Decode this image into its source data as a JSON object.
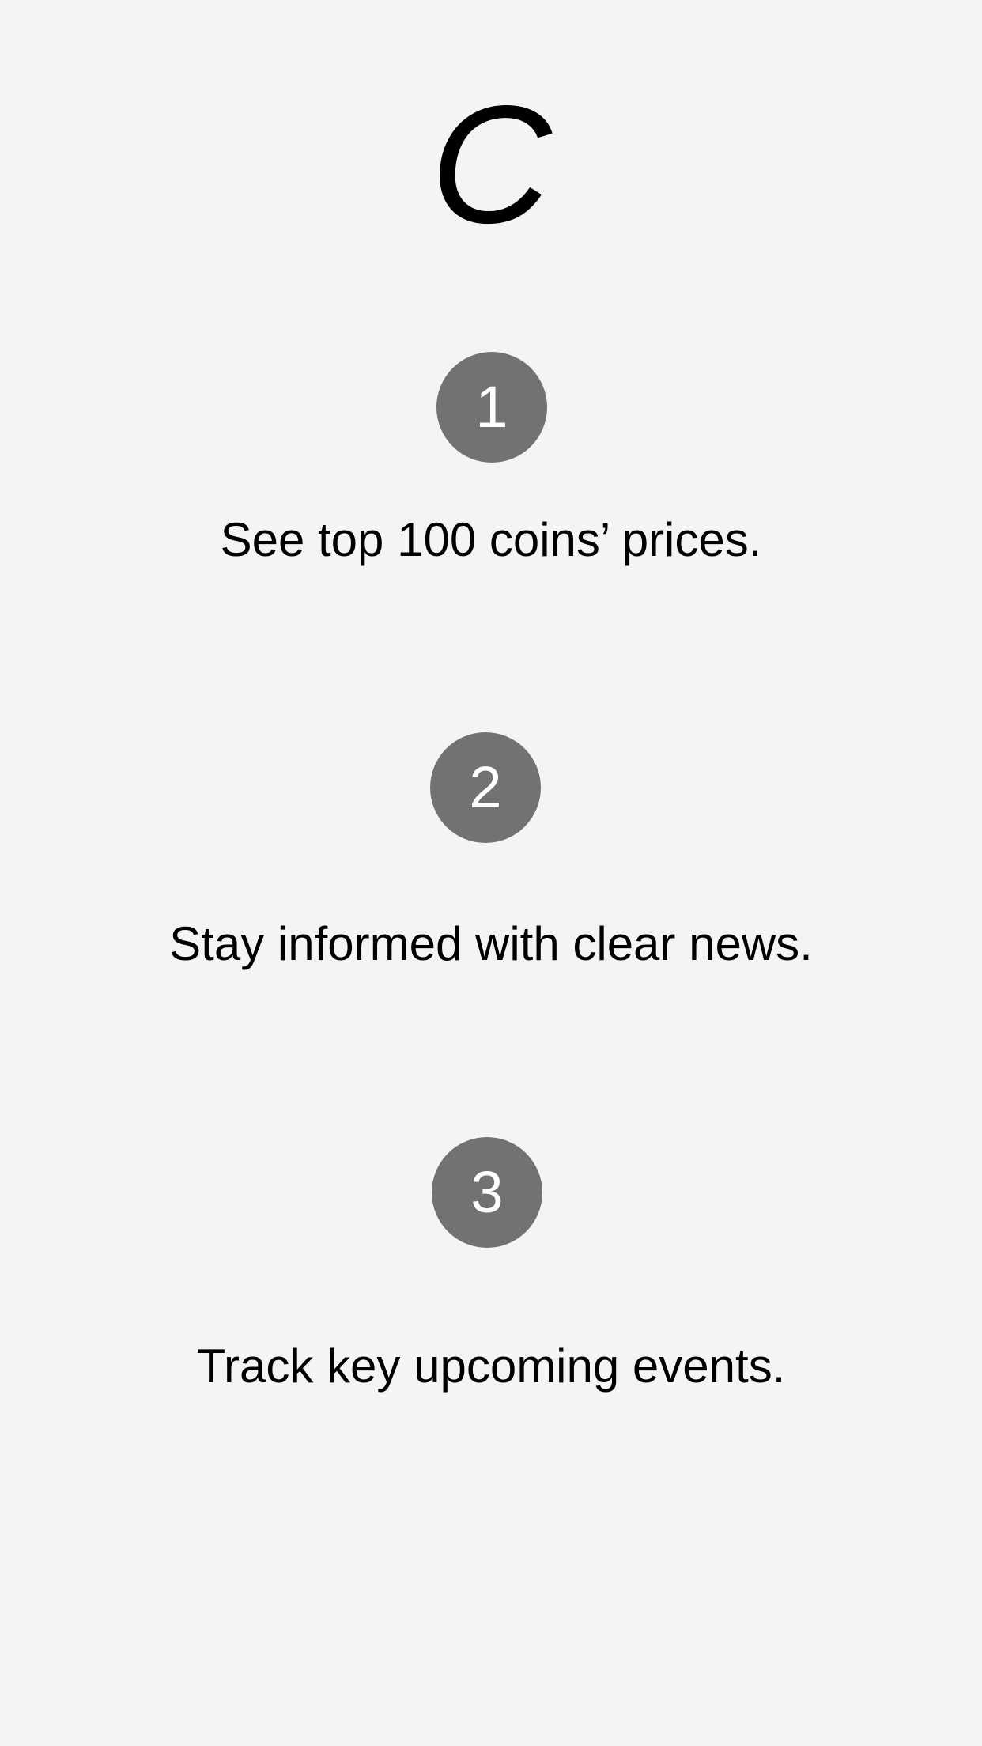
{
  "logo": {
    "letter": "C"
  },
  "colors": {
    "background": "#f3f5f5",
    "badge": "#727272",
    "text": "#000000"
  },
  "steps": [
    {
      "number": "1",
      "text": "See top 100 coins’ prices."
    },
    {
      "number": "2",
      "text": "Stay informed with clear news."
    },
    {
      "number": "3",
      "text": "Track key upcoming events."
    }
  ]
}
